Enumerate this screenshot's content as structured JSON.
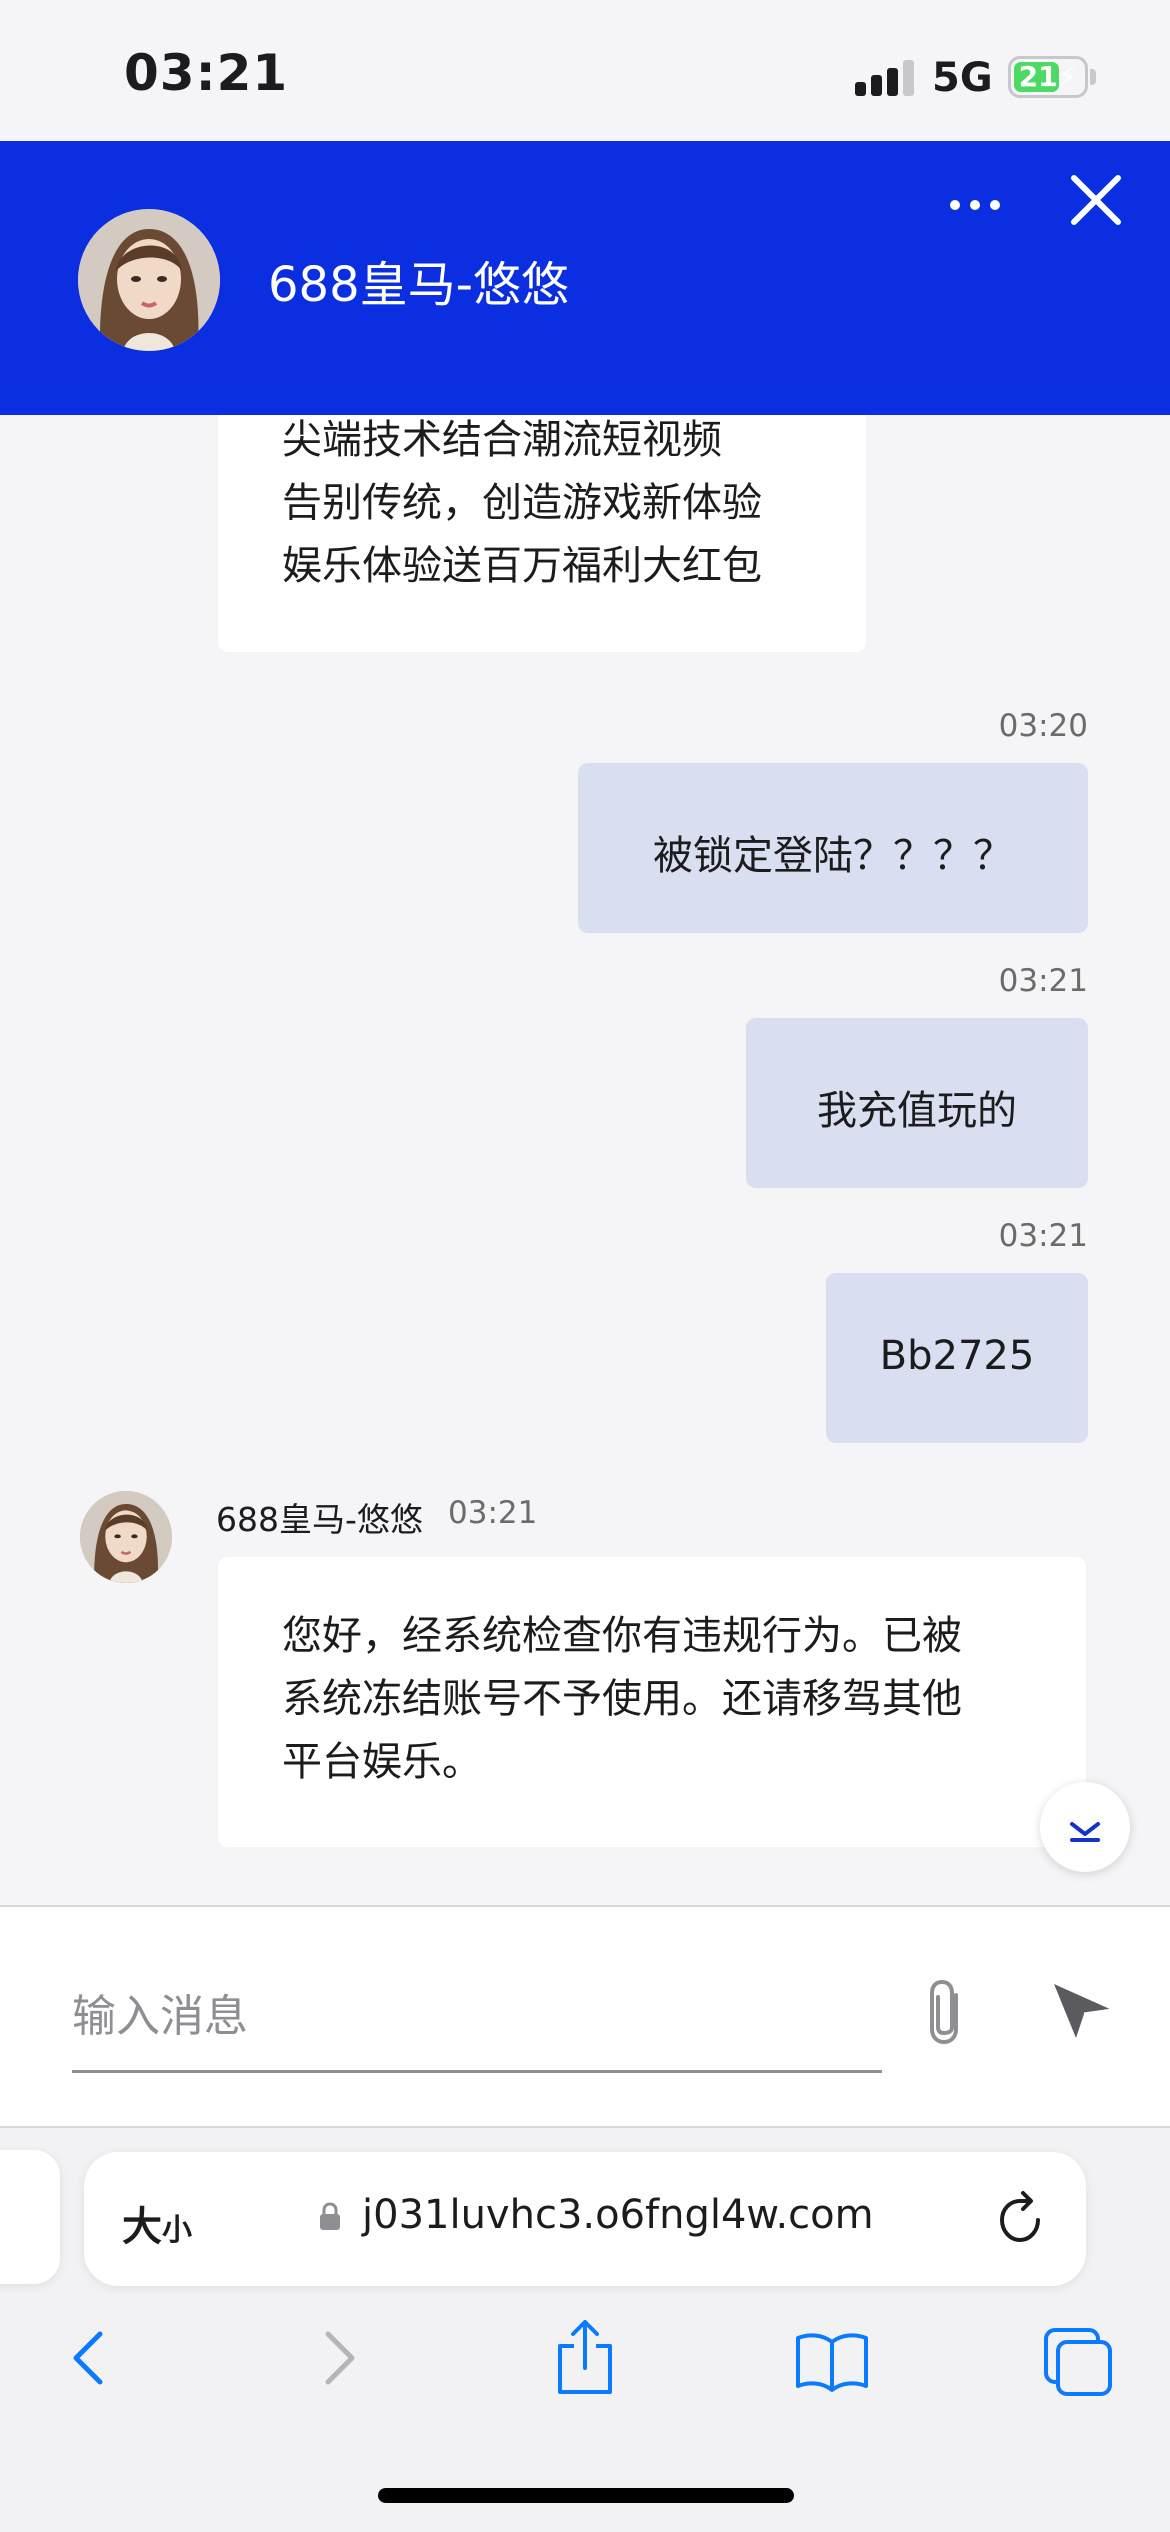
{
  "status_bar": {
    "time": "03:21",
    "network": "5G",
    "battery_level": "21"
  },
  "header": {
    "agent_name": "688皇马-悠悠",
    "color": "#0a2ee0"
  },
  "messages": {
    "partial_incoming": {
      "lines": [
        "尖端技术结合潮流短视频",
        "告别传统，创造游戏新体验",
        "娱乐体验送百万福利大红包"
      ]
    },
    "outgoing": [
      {
        "time": "03:20",
        "text": "被锁定登陆？？？？"
      },
      {
        "time": "03:21",
        "text": "我充值玩的"
      },
      {
        "time": "03:21",
        "text": "Bb2725"
      }
    ],
    "reply": {
      "sender": "688皇马-悠悠",
      "time": "03:21",
      "lines": [
        "您好，经系统检查你有违规行为。已被",
        "系统冻结账号不予使用。还请移驾其他",
        "平台娱乐。"
      ]
    },
    "outgoing_bubble_color": "#d9dff0"
  },
  "composer": {
    "placeholder": "输入消息",
    "value": ""
  },
  "browser": {
    "text_size_big": "大",
    "text_size_small": "小",
    "url": "j031luvhc3.o6fngl4w.com",
    "accent_color": "#0a7aff"
  }
}
